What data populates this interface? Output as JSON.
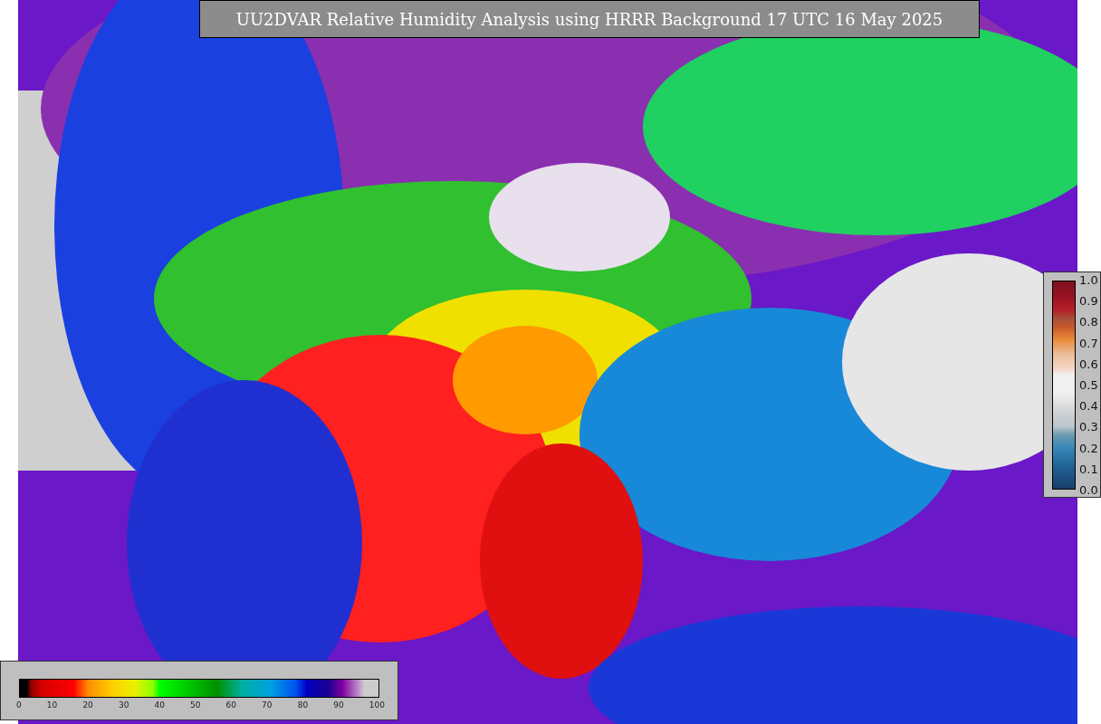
{
  "title": "UU2DVAR Relative Humidity Analysis using HRRR Background 17 UTC 16 May 2025",
  "obs_colorbar": {
    "ticks": [
      "1.0",
      "0.9",
      "0.8",
      "0.7",
      "0.6",
      "0.5",
      "0.4",
      "0.3",
      "0.2",
      "0.1",
      "0.0"
    ]
  },
  "field_colorbar": {
    "ticks": [
      "0",
      "10",
      "20",
      "30",
      "40",
      "50",
      "60",
      "70",
      "80",
      "90",
      "100"
    ]
  }
}
